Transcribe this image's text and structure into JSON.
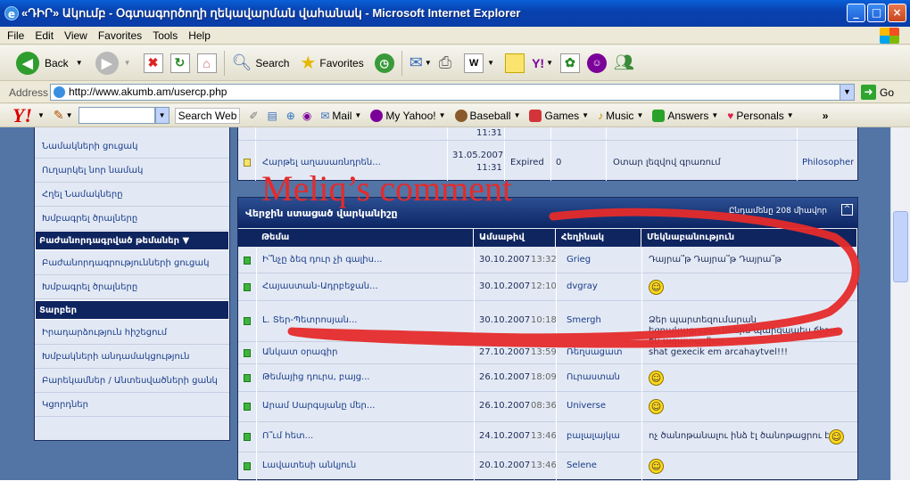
{
  "window": {
    "title": "«ԴԻՐ» Ակումբ - Օգտագործողի ղեկավարման վահանակ - Microsoft Internet Explorer"
  },
  "menu": [
    "File",
    "Edit",
    "View",
    "Favorites",
    "Tools",
    "Help"
  ],
  "toolbar": {
    "back": "Back",
    "search": "Search",
    "favorites": "Favorites"
  },
  "address": {
    "label": "Address",
    "url": "http://www.akumb.am/usercp.php",
    "go": "Go"
  },
  "yahoo_bar": {
    "logo": "Y!",
    "search_web": "Search Web",
    "mail": "Mail",
    "my_yahoo": "My Yahoo!",
    "baseball": "Baseball",
    "games": "Games",
    "music": "Music",
    "answers": "Answers",
    "personals": "Personals"
  },
  "sidebar": {
    "items_top": [
      "Նամակների ցուցակ",
      "Ուղարկել նոր նամակ",
      "Հղել Նամակները",
      "Խմբագրել ծրալները"
    ],
    "head1": "Բաժանորդագրված թեմաներ",
    "items_mid": [
      "Բաժանորդագրությունների ցուցակ",
      "Խմբագրել ծրալները"
    ],
    "head2": "Տարբեր",
    "items_bot": [
      "Իրադարձություն հիշեցում",
      "Խմբակների անդամակցություն",
      "Բարեկամներ / Անտեսվածների ցանկ",
      "Կցորդներ"
    ]
  },
  "top_row": {
    "thread": "Հարթել աղասառնդրեն...",
    "date": "31.05.2007",
    "time": "11:31",
    "status": "Expired",
    "count": "0",
    "note": "Օտար լեզվով գրառում",
    "user": "Philosopher",
    "prev_time": "11:31"
  },
  "panel": {
    "title": "Վերջին ստացած վարկանիշը",
    "count": "Ընդամենը 208 միավոր",
    "collapse": "^",
    "columns": [
      "Թեմա",
      "Ամսաթիվ",
      "Հեղինակ",
      "Մեկնաբանություն"
    ],
    "rows": [
      {
        "thread": "Ի՞նչը ձեզ դուր չի գալիս...",
        "date": "30.10.2007",
        "time": "13:32",
        "author": "Grieg",
        "comment": "Դայրա՞թ Դայրա՞թ Դայրա՞թ",
        "smiley": ""
      },
      {
        "thread": "Հայաստան-Ադրբեջան...",
        "date": "30.10.2007",
        "time": "12:10",
        "author": "dvgray",
        "comment": "",
        "smiley": "☺"
      },
      {
        "thread": "Լ. Տեր-Պետրոսյան...",
        "date": "30.10.2007",
        "time": "10:18",
        "author": "Smergh",
        "comment": "Ձեր պարտեզումարան եզրակացություններն պարզապես ճիշտ են ազատամիտ",
        "smiley": ""
      },
      {
        "thread": "Անկատ օրագիր",
        "date": "27.10.2007",
        "time": "13:59",
        "author": "Ռեղսացատ",
        "comment": "shat gexecik em arcahaytvel!!!",
        "smiley": ""
      },
      {
        "thread": "Թեմայից դուրս, բայց...",
        "date": "26.10.2007",
        "time": "18:09",
        "author": "Ուրաստան",
        "comment": "",
        "smiley": "☺"
      },
      {
        "thread": "Արամ Սարգսյանը մեր...",
        "date": "26.10.2007",
        "time": "08:36",
        "author": "Universe",
        "comment": "",
        "smiley": "☺"
      },
      {
        "thread": "Ո՞ւմ հետ...",
        "date": "24.10.2007",
        "time": "13:46",
        "author": "բալալայկա",
        "comment": "ոչ ծանոթանալու ինձ էլ ծանոթացրու էլի",
        "smiley": "☺"
      },
      {
        "thread": "Լավատեսի անկյուն",
        "date": "20.10.2007",
        "time": "13:46",
        "author": "Selene",
        "comment": "",
        "smiley": "☺"
      }
    ]
  },
  "annotation": {
    "text": "Meliq’s comment",
    "color": "#e52b2b"
  }
}
